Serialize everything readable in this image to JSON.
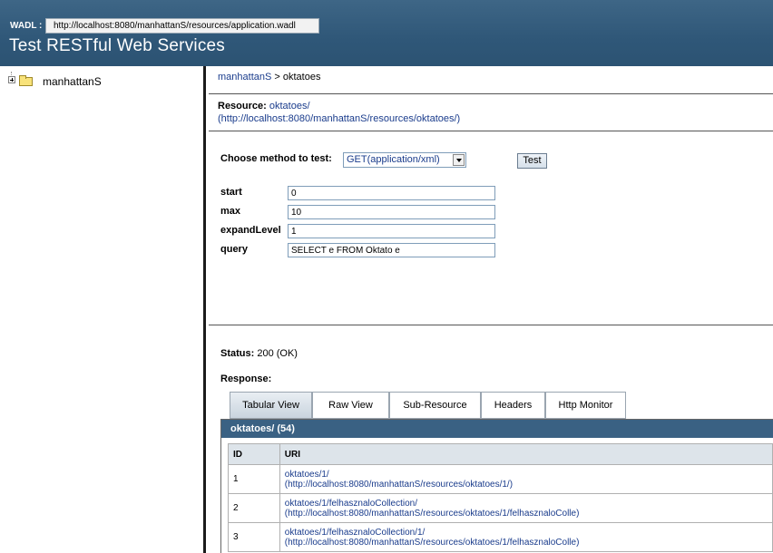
{
  "header": {
    "wadl_label": "WADL :",
    "wadl_url": "http://localhost:8080/manhattanS/resources/application.wadl",
    "title": "Test RESTful Web Services"
  },
  "tree": {
    "root_label": "manhattanS"
  },
  "breadcrumb": {
    "root": "manhattanS",
    "separator": " > ",
    "current": "oktatoes"
  },
  "resource": {
    "label": "Resource:",
    "name": "oktatoes/",
    "url": "(http://localhost:8080/manhattanS/resources/oktatoes/)"
  },
  "method": {
    "label": "Choose method to test:",
    "selected": "GET(application/xml)",
    "test_button": "Test"
  },
  "params": [
    {
      "label": "start",
      "value": "0"
    },
    {
      "label": "max",
      "value": "10"
    },
    {
      "label": "expandLevel",
      "value": "1"
    },
    {
      "label": "query",
      "value": "SELECT e FROM Oktato e"
    }
  ],
  "status": {
    "label": "Status:",
    "value": "200 (OK)"
  },
  "response": {
    "label": "Response:",
    "tabs": [
      "Tabular View",
      "Raw View",
      "Sub-Resource",
      "Headers",
      "Http Monitor"
    ],
    "active_tab": "Tabular View",
    "panel_title": "oktatoes/ (54)",
    "columns": [
      "ID",
      "URI"
    ],
    "rows": [
      {
        "id": "1",
        "uri": "oktatoes/1/",
        "url": "(http://localhost:8080/manhattanS/resources/oktatoes/1/)"
      },
      {
        "id": "2",
        "uri": "oktatoes/1/felhasznaloCollection/",
        "url": "(http://localhost:8080/manhattanS/resources/oktatoes/1/felhasznaloColle)"
      },
      {
        "id": "3",
        "uri": "oktatoes/1/felhasznaloCollection/1/",
        "url": "(http://localhost:8080/manhattanS/resources/oktatoes/1/felhasznaloColle)"
      }
    ]
  },
  "colors": {
    "header_bg": "#2f5778",
    "panel_title_bg": "#3a6183",
    "link": "#1a3c8c"
  }
}
